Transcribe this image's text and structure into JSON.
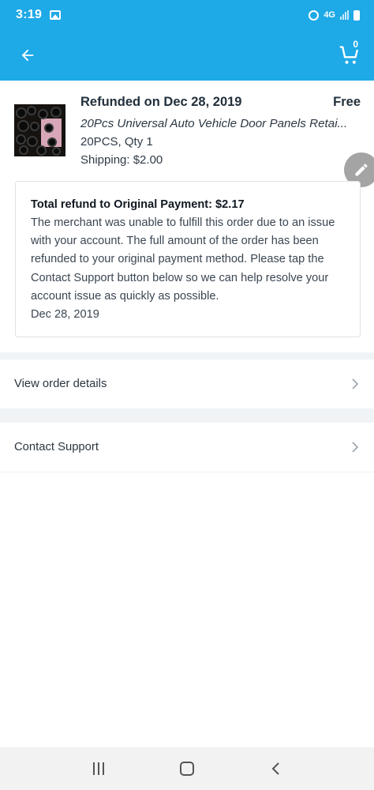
{
  "status_bar": {
    "time": "3:19",
    "network": "4G"
  },
  "app_bar": {
    "back_icon": "arrow-left-icon",
    "cart_icon": "cart-icon",
    "cart_count": "0"
  },
  "order": {
    "status": "Refunded on Dec 28, 2019",
    "price": "Free",
    "product_name": "20Pcs Universal Auto Vehicle Door Panels Retai...",
    "variant": "20PCS, Qty 1",
    "shipping": "Shipping: $2.00"
  },
  "refund": {
    "title": "Total refund to Original Payment: $2.17",
    "message": "The merchant was unable to fulfill this order due to an issue with your account. The full amount of the order has been refunded to your original payment method. Please tap the Contact Support button below so we can help resolve your account issue as quickly as possible.",
    "date": "Dec 28, 2019"
  },
  "actions": [
    {
      "label": "View order details"
    },
    {
      "label": "Contact Support"
    }
  ],
  "colors": {
    "accent": "#1ea9e7",
    "fab": "#a4a4a4",
    "divider": "#f1f4f6"
  }
}
